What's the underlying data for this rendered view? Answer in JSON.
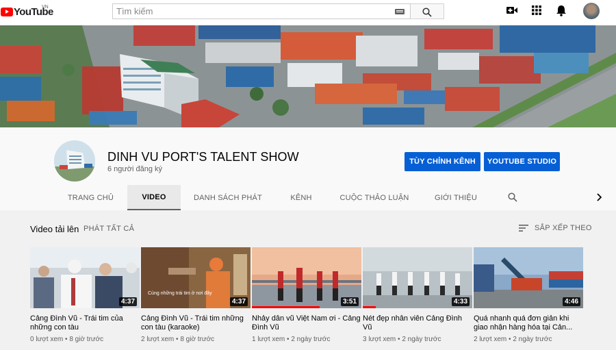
{
  "masthead": {
    "logo_text": "YouTube",
    "country": "VN",
    "search_placeholder": "Tìm kiếm"
  },
  "channel": {
    "name": "DINH VU PORT'S TALENT SHOW",
    "subscribers": "6 người đăng ký",
    "customize_label": "TÙY CHỈNH KÊNH",
    "studio_label": "YOUTUBE STUDIO"
  },
  "tabs": [
    {
      "label": "TRANG CHỦ",
      "active": false
    },
    {
      "label": "VIDEO",
      "active": true
    },
    {
      "label": "DANH SÁCH PHÁT",
      "active": false
    },
    {
      "label": "KÊNH",
      "active": false
    },
    {
      "label": "CUỘC THẢO LUẬN",
      "active": false
    },
    {
      "label": "GIỚI THIỆU",
      "active": false
    }
  ],
  "section": {
    "title": "Video tải lên",
    "play_all": "PHÁT TẤT CẢ",
    "sort_label": "SẮP XẾP THEO"
  },
  "videos": [
    {
      "title": "Cảng Đình Vũ - Trái tim của những con tàu",
      "views": "0 lượt xem",
      "age": "8 giờ trước",
      "duration": "4:37",
      "watched": 0
    },
    {
      "title": "Cảng Đình Vũ - Trái tim những con tàu (karaoke)",
      "views": "2 lượt xem",
      "age": "8 giờ trước",
      "duration": "4:37",
      "watched": 0,
      "caption": "Cùng những trái tim ở nơi đây"
    },
    {
      "title": "Nhảy dân vũ Việt Nam ơi - Cảng Đình Vũ",
      "views": "1 lượt xem",
      "age": "2 ngày trước",
      "duration": "3:51",
      "watched": 0.62
    },
    {
      "title": "Nét đẹp nhân viên Cảng Đình Vũ",
      "views": "3 lượt xem",
      "age": "2 ngày trước",
      "duration": "4:33",
      "watched": 0.12
    },
    {
      "title": "Quá nhanh quá đơn giản khi giao nhận hàng hóa tại Cản...",
      "views": "2 lượt xem",
      "age": "2 ngày trước",
      "duration": "4:46",
      "watched": 0
    }
  ],
  "colors": {
    "brand_red": "#ff0000",
    "button_blue": "#065fd4",
    "progress_red": "#ff0000"
  },
  "icons": [
    "youtube-logo-icon",
    "keyboard-icon",
    "search-icon",
    "create-video-icon",
    "apps-icon",
    "notifications-icon",
    "avatar",
    "sort-icon",
    "chevron-right-icon"
  ]
}
